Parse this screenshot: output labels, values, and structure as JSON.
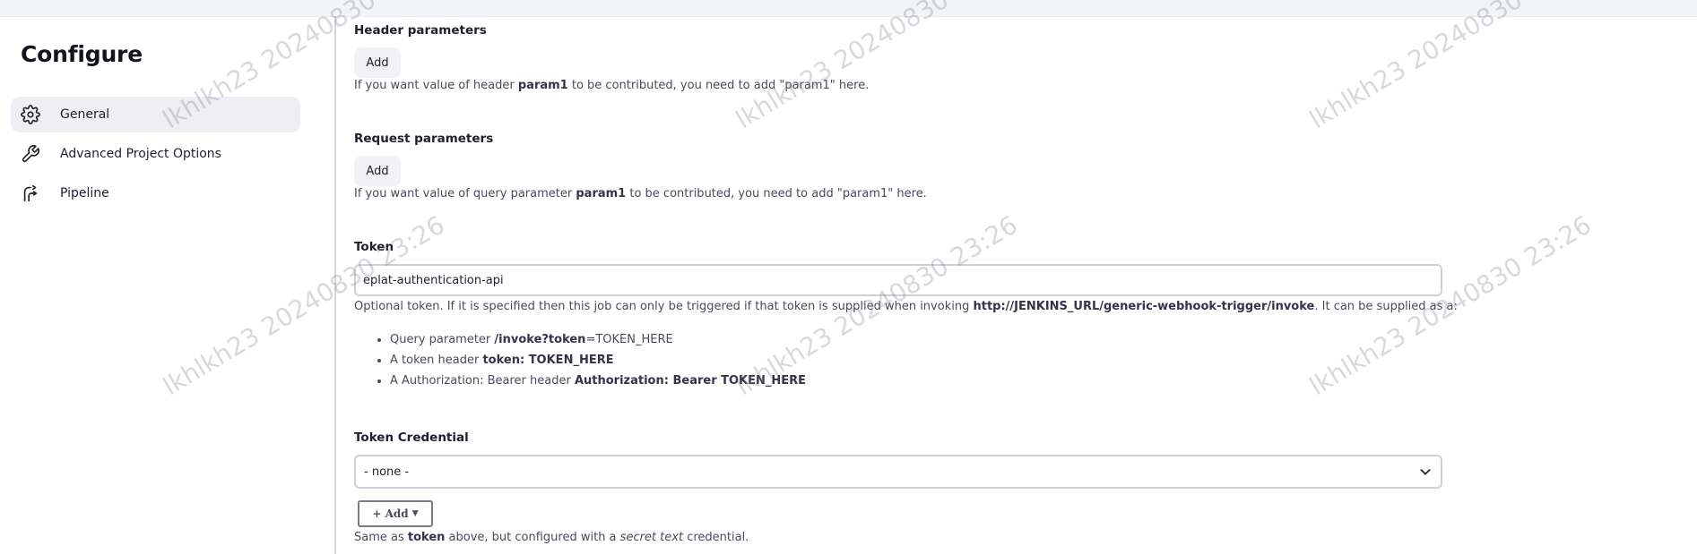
{
  "sidebar": {
    "title": "Configure",
    "items": [
      {
        "label": "General",
        "icon": "gear-icon",
        "active": true
      },
      {
        "label": "Advanced Project Options",
        "icon": "wrench-icon",
        "active": false
      },
      {
        "label": "Pipeline",
        "icon": "pipeline-icon",
        "active": false
      }
    ]
  },
  "header_parameters": {
    "title": "Header parameters",
    "add_label": "Add",
    "help_before": "If you want value of header ",
    "help_param": "param1",
    "help_after": " to be contributed, you need to add \"param1\" here."
  },
  "request_parameters": {
    "title": "Request parameters",
    "add_label": "Add",
    "help_before": "If you want value of query parameter ",
    "help_param": "param1",
    "help_after": " to be contributed, you need to add \"param1\" here."
  },
  "token": {
    "title": "Token",
    "value": "eplat-authentication-api",
    "help_before": "Optional token. If it is specified then this job can only be triggered if that token is supplied when invoking ",
    "help_url": "http://JENKINS_URL/generic-webhook-trigger/invoke",
    "help_after": ". It can be supplied as a:",
    "bullets": [
      {
        "prefix": "Query parameter ",
        "code": "/invoke?token",
        "suffix": "=TOKEN_HERE"
      },
      {
        "prefix": "A token header ",
        "code": "token: TOKEN_HERE",
        "suffix": ""
      },
      {
        "prefix": "A Authorization: Bearer header ",
        "code": "Authorization: Bearer TOKEN_HERE",
        "suffix": ""
      }
    ]
  },
  "token_credential": {
    "title": "Token Credential",
    "selected": "- none -",
    "add_label": "+ Add",
    "help_before": "Same as ",
    "help_token": "token",
    "help_middle": " above, but configured with a ",
    "help_em": "secret text",
    "help_after": " credential."
  },
  "watermark": {
    "text": "lkhlkh23 20240830 23:26"
  },
  "colors": {
    "sidebar_active_bg": "#eeeef4",
    "divider": "#d4d4dc",
    "input_border": "#cfcfd8"
  }
}
